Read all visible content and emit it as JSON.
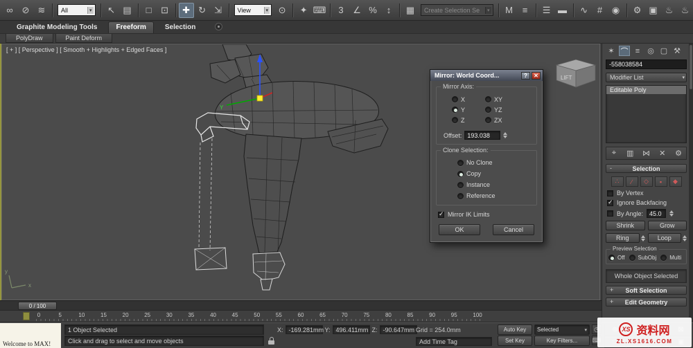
{
  "toolbar": {
    "items": [
      {
        "kind": "icon",
        "name": "select-and-link-icon",
        "glyph": "∞"
      },
      {
        "kind": "icon",
        "name": "unlink-selection-icon",
        "glyph": "⊘"
      },
      {
        "kind": "icon",
        "name": "bind-to-space-warp-icon",
        "glyph": "≋"
      },
      {
        "kind": "sep"
      },
      {
        "kind": "dropdown",
        "name": "selection-filter-dropdown",
        "value": "All"
      },
      {
        "kind": "sep"
      },
      {
        "kind": "icon",
        "name": "select-object-icon",
        "glyph": "↖"
      },
      {
        "kind": "icon",
        "name": "select-by-name-icon",
        "glyph": "▤"
      },
      {
        "kind": "sep"
      },
      {
        "kind": "icon",
        "name": "rectangular-selection-region-icon",
        "glyph": "□"
      },
      {
        "kind": "icon",
        "name": "window-crossing-toggle-icon",
        "glyph": "⊡"
      },
      {
        "kind": "sep"
      },
      {
        "kind": "icon",
        "name": "select-and-move-icon",
        "glyph": "✚",
        "active": true
      },
      {
        "kind": "icon",
        "name": "select-and-rotate-icon",
        "glyph": "↻"
      },
      {
        "kind": "icon",
        "name": "select-and-scale-icon",
        "glyph": "⇲"
      },
      {
        "kind": "sep"
      },
      {
        "kind": "dropdown",
        "name": "reference-coordinate-system-dropdown",
        "value": "View"
      },
      {
        "kind": "icon",
        "name": "use-pivot-point-center-icon",
        "glyph": "⊙"
      },
      {
        "kind": "sep"
      },
      {
        "kind": "icon",
        "name": "select-and-manipulate-icon",
        "glyph": "✦"
      },
      {
        "kind": "icon",
        "name": "keyboard-shortcut-override-icon",
        "glyph": "⌨"
      },
      {
        "kind": "sep"
      },
      {
        "kind": "icon",
        "name": "snaps-toggle-icon",
        "glyph": "3"
      },
      {
        "kind": "icon",
        "name": "angle-snap-toggle-icon",
        "glyph": "∠"
      },
      {
        "kind": "icon",
        "name": "percent-snap-toggle-icon",
        "glyph": "%"
      },
      {
        "kind": "icon",
        "name": "spinner-snap-toggle-icon",
        "glyph": "↕"
      },
      {
        "kind": "sep"
      },
      {
        "kind": "icon",
        "name": "edit-named-selection-sets-icon",
        "glyph": "▦"
      },
      {
        "kind": "dropdown",
        "name": "named-selection-sets-dropdown",
        "value": "Create Selection Se",
        "disabled": true
      },
      {
        "kind": "sep"
      },
      {
        "kind": "icon",
        "name": "mirror-icon",
        "glyph": "M"
      },
      {
        "kind": "icon",
        "name": "align-icon",
        "glyph": "≡"
      },
      {
        "kind": "sep"
      },
      {
        "kind": "icon",
        "name": "layer-manager-icon",
        "glyph": "☰"
      },
      {
        "kind": "icon",
        "name": "graphite-ribbon-toggle-icon",
        "glyph": "▬"
      },
      {
        "kind": "sep"
      },
      {
        "kind": "icon",
        "name": "curve-editor-icon",
        "glyph": "∿"
      },
      {
        "kind": "icon",
        "name": "schematic-view-icon",
        "glyph": "#"
      },
      {
        "kind": "icon",
        "name": "material-editor-icon",
        "glyph": "◉"
      },
      {
        "kind": "sep"
      },
      {
        "kind": "icon",
        "name": "render-setup-icon",
        "glyph": "⚙"
      },
      {
        "kind": "icon",
        "name": "rendered-frame-window-icon",
        "glyph": "▣"
      },
      {
        "kind": "icon",
        "name": "render-production-icon",
        "glyph": "♨"
      },
      {
        "kind": "icon",
        "name": "render-iterative-icon",
        "glyph": "♨"
      }
    ]
  },
  "ribbon": {
    "tabs": [
      {
        "label": "Graphite Modeling Tools",
        "active": false
      },
      {
        "label": "Freeform",
        "active": true
      },
      {
        "label": "Selection",
        "active": false
      }
    ],
    "subtabs": [
      "PolyDraw",
      "Paint Deform"
    ]
  },
  "viewport": {
    "label": "[ + ]  [ Perspective ]  [ Smooth + Highlights + Edged Faces ]",
    "viewcube_label": "LIFT",
    "gizmo_axis_label": "Y",
    "axis_x": "x",
    "axis_y": "y"
  },
  "dialog": {
    "title": "Mirror: World Coord...",
    "help_button": "?",
    "close_button": "✕",
    "mirror_axis": {
      "label": "Mirror Axis:",
      "options": [
        "X",
        "Y",
        "Z",
        "XY",
        "YZ",
        "ZX"
      ],
      "selected": "Y"
    },
    "offset": {
      "label": "Offset:",
      "value": "193.038"
    },
    "clone": {
      "label": "Clone Selection:",
      "options": [
        "No Clone",
        "Copy",
        "Instance",
        "Reference"
      ],
      "selected": "Copy"
    },
    "mirror_ik": {
      "label": "Mirror IK Limits",
      "checked": true
    },
    "buttons": {
      "ok": "OK",
      "cancel": "Cancel"
    }
  },
  "command_panel": {
    "tabs": [
      {
        "name": "create-tab-icon",
        "glyph": "✶"
      },
      {
        "name": "modify-tab-icon",
        "glyph": "⌒",
        "active": true
      },
      {
        "name": "hierarchy-tab-icon",
        "glyph": "≡"
      },
      {
        "name": "motion-tab-icon",
        "glyph": "◎"
      },
      {
        "name": "display-tab-icon",
        "glyph": "▢"
      },
      {
        "name": "utilities-tab-icon",
        "glyph": "⚒"
      }
    ],
    "object_name": "-558038584",
    "modifier_list_label": "Modifier List",
    "stack": [
      "Editable Poly"
    ],
    "stack_tools": [
      {
        "name": "pin-stack-icon",
        "glyph": "⌖"
      },
      {
        "name": "show-end-result-icon",
        "glyph": "▥"
      },
      {
        "name": "make-unique-icon",
        "glyph": "⋈"
      },
      {
        "name": "remove-modifier-icon",
        "glyph": "✕"
      },
      {
        "name": "configure-modifier-sets-icon",
        "glyph": "⚙"
      }
    ],
    "selection": {
      "title": "Selection",
      "subobject_icons": [
        {
          "name": "vertex-mode-icon",
          "glyph": "∴"
        },
        {
          "name": "edge-mode-icon",
          "glyph": "∕"
        },
        {
          "name": "border-mode-icon",
          "glyph": "◇"
        },
        {
          "name": "polygon-mode-icon",
          "glyph": "▪"
        },
        {
          "name": "element-mode-icon",
          "glyph": "◆"
        }
      ],
      "checkboxes": {
        "by_vertex": {
          "label": "By Vertex",
          "checked": false
        },
        "ignore_backfacing": {
          "label": "Ignore Backfacing",
          "checked": true
        },
        "by_angle": {
          "label": "By Angle:",
          "checked": false,
          "value": "45.0"
        }
      },
      "buttons": {
        "shrink": "Shrink",
        "grow": "Grow",
        "ring": "Ring",
        "loop": "Loop"
      },
      "preview": {
        "label": "Preview Selection",
        "options": [
          "Off",
          "SubObj",
          "Multi"
        ],
        "selected": "Off"
      },
      "status": "Whole Object Selected"
    },
    "rollouts": [
      {
        "label": "Soft Selection",
        "expanded": false
      },
      {
        "label": "Edit Geometry",
        "expanded": false
      }
    ]
  },
  "timeline": {
    "slider_label": "0 / 100",
    "ticks": [
      "0",
      "5",
      "10",
      "15",
      "20",
      "25",
      "30",
      "35",
      "40",
      "45",
      "50",
      "55",
      "60",
      "65",
      "70",
      "75",
      "80",
      "85",
      "90",
      "95",
      "100"
    ]
  },
  "status_bar": {
    "welcome": "Welcome to MAX!",
    "selection_info": "1 Object Selected",
    "prompt": "Click and drag to select and move objects",
    "coords": {
      "x_label": "X:",
      "x": "-169.281mm",
      "y_label": "Y:",
      "y": "496.411mm",
      "z_label": "Z:",
      "z": "-90.647mm"
    },
    "grid": "Grid = 254.0mm",
    "add_time_tag": "Add Time Tag",
    "auto_key": "Auto Key",
    "set_key": "Set Key",
    "selected_dropdown": "Selected",
    "key_filters": "Key Filters...",
    "mini_icons": [
      {
        "name": "time-configuration-icon",
        "glyph": "◷"
      },
      {
        "name": "keyboard-entry-icon",
        "glyph": "⌨"
      }
    ],
    "nav_icons": [
      {
        "name": "zoom-icon",
        "glyph": "⊕"
      },
      {
        "name": "zoom-all-icon",
        "glyph": "⊞"
      },
      {
        "name": "zoom-extents-icon",
        "glyph": "⊡"
      },
      {
        "name": "zoom-extents-all-icon",
        "glyph": "⊠"
      },
      {
        "name": "zoom-region-icon",
        "glyph": "□"
      },
      {
        "name": "pan-view-icon",
        "glyph": "⇄"
      },
      {
        "name": "orbit-icon",
        "glyph": "↻"
      },
      {
        "name": "maximize-viewport-icon",
        "glyph": "▣"
      }
    ]
  },
  "watermark": {
    "logo_text": "XS",
    "brand": "资料网",
    "site": "ZL.XS1616.COM"
  },
  "colors": {
    "accent_axis_x": "#d22222",
    "accent_axis_y": "#00aa00",
    "accent_axis_z": "#2a52ff",
    "watermark_red": "#cf1f1f"
  }
}
